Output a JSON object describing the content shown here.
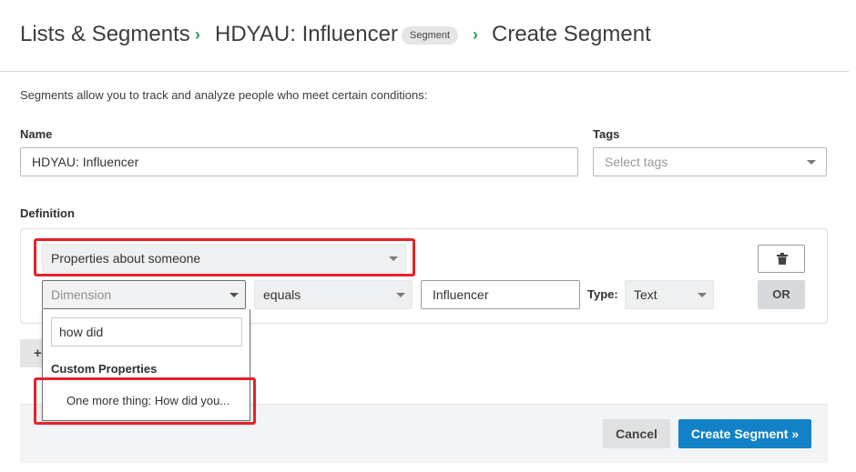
{
  "breadcrumb": {
    "root": "Lists & Segments",
    "list": "HDYAU: Influencer",
    "badge": "Segment",
    "current": "Create Segment"
  },
  "intro": "Segments allow you to track and analyze people who meet certain conditions:",
  "form": {
    "name_label": "Name",
    "name_value": "HDYAU: Influencer",
    "tags_label": "Tags",
    "tags_placeholder": "Select tags",
    "definition_label": "Definition"
  },
  "definition": {
    "condition_type": "Properties about someone",
    "dimension_placeholder": "Dimension",
    "operator": "equals",
    "value": "Influencer",
    "type_label": "Type:",
    "type_value": "Text",
    "or_label": "OR",
    "add_label": "+"
  },
  "dropdown": {
    "search_value": "how did",
    "group_label": "Custom Properties",
    "option": "One more thing: How did you..."
  },
  "actions": {
    "cancel": "Cancel",
    "create": "Create Segment »"
  },
  "colors": {
    "accent_green": "#1fa15c",
    "primary_blue": "#1282c8",
    "highlight_red": "#e8202a"
  }
}
